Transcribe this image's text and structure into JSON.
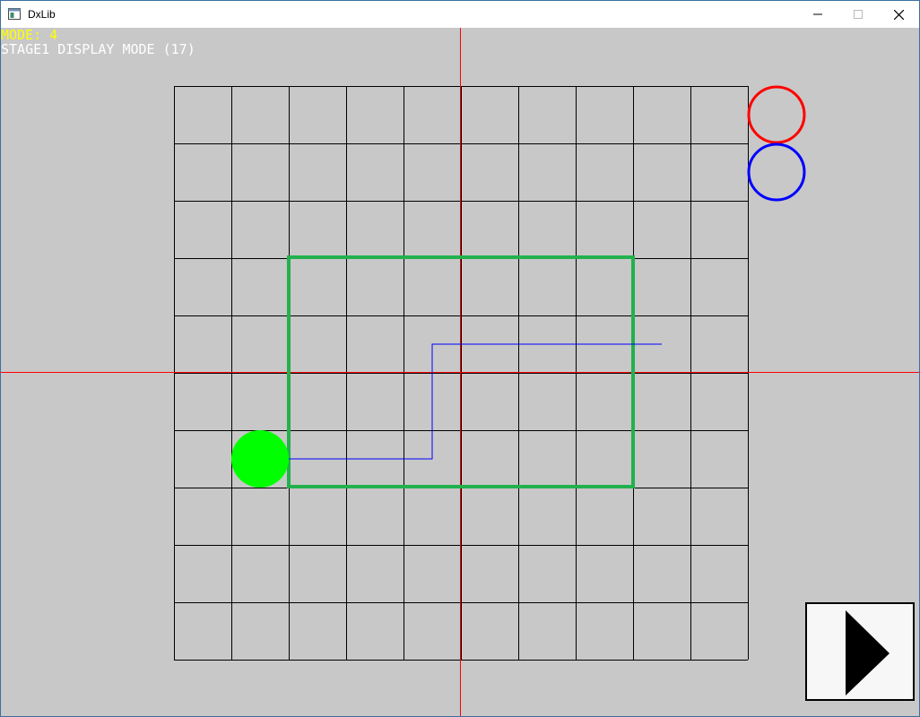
{
  "window": {
    "title": "DxLib",
    "controls": [
      "minimize",
      "maximize",
      "close"
    ]
  },
  "hud": {
    "mode_line": "MODE: 4",
    "stage_line": "STAGE1 DISPLAY MODE (17)"
  },
  "grid": {
    "rows": 10,
    "cols": 10
  },
  "colors": {
    "background": "#c8c8c8",
    "grid_line": "#000000",
    "crosshair": "#ff0000",
    "selection_rect": "#22b14c",
    "path": "#0000ff",
    "player": "#00ff00",
    "indicator_red": "#ff0000",
    "indicator_blue": "#0000ff",
    "hud_mode": "#ffff00",
    "hud_stage": "#ffffff"
  },
  "icons": {
    "next_button": "play-triangle-icon"
  }
}
